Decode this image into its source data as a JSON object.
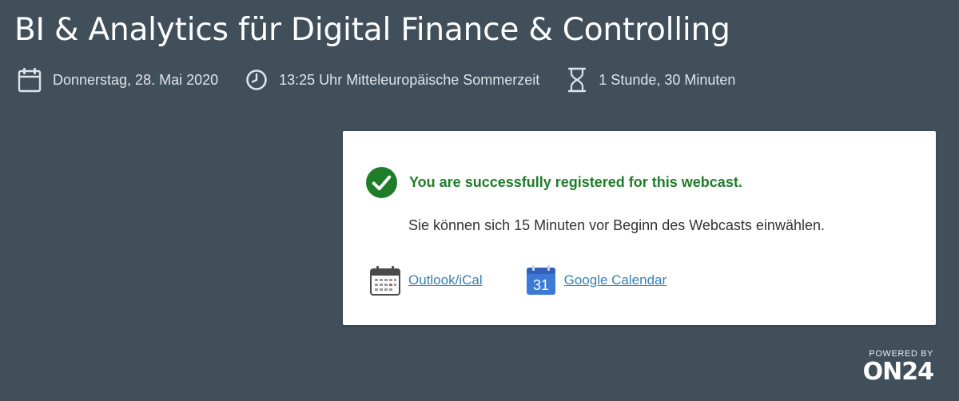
{
  "header": {
    "title": "BI & Analytics für Digital Finance & Controlling"
  },
  "meta": {
    "date": {
      "icon": "calendar-icon",
      "text": "Donnerstag, 28. Mai 2020"
    },
    "time": {
      "icon": "clock-icon",
      "text": "13:25 Uhr Mitteleuropäische Sommerzeit"
    },
    "duration": {
      "icon": "hourglass-icon",
      "text": "1 Stunde, 30 Minuten"
    }
  },
  "registration": {
    "status_icon": "check-circle-icon",
    "success_message": "You are successfully registered for this webcast.",
    "info_message": "Sie können sich 15 Minuten vor Beginn des Webcasts einwählen.",
    "calendar_links": [
      {
        "icon": "outlook-calendar-icon",
        "label": "Outlook/iCal"
      },
      {
        "icon": "google-calendar-icon",
        "label": "Google Calendar",
        "icon_text": "31"
      }
    ]
  },
  "footer": {
    "powered_label": "POWERED BY",
    "logo_text": "ON24"
  },
  "colors": {
    "background": "#414f5b",
    "success": "#1f7d2a",
    "link": "#3a7fb0",
    "google_blue": "#3d7ad8"
  }
}
